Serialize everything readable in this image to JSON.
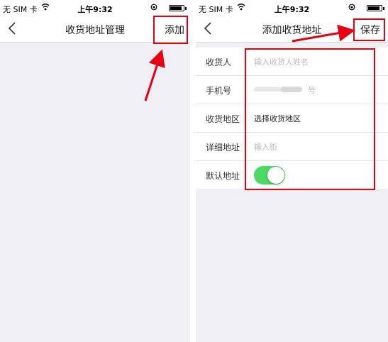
{
  "status_bar": {
    "carrier": "无 SIM 卡",
    "time": "上午9:32"
  },
  "left_screen": {
    "title": "收货地址管理",
    "action": "添加"
  },
  "right_screen": {
    "title": "添加收货地址",
    "action": "保存",
    "form": [
      {
        "label": "收货人",
        "placeholder": "输入收货人姓名"
      },
      {
        "label": "手机号",
        "placeholder": "号"
      },
      {
        "label": "收货地区",
        "value": "选择收货地区"
      },
      {
        "label": "详细地址",
        "placeholder": "输入街"
      },
      {
        "label": "默认地址",
        "toggle_on": true
      }
    ]
  },
  "colors": {
    "highlight": "#e60012",
    "toggle": "#4cd964",
    "background": "#efeff4"
  }
}
